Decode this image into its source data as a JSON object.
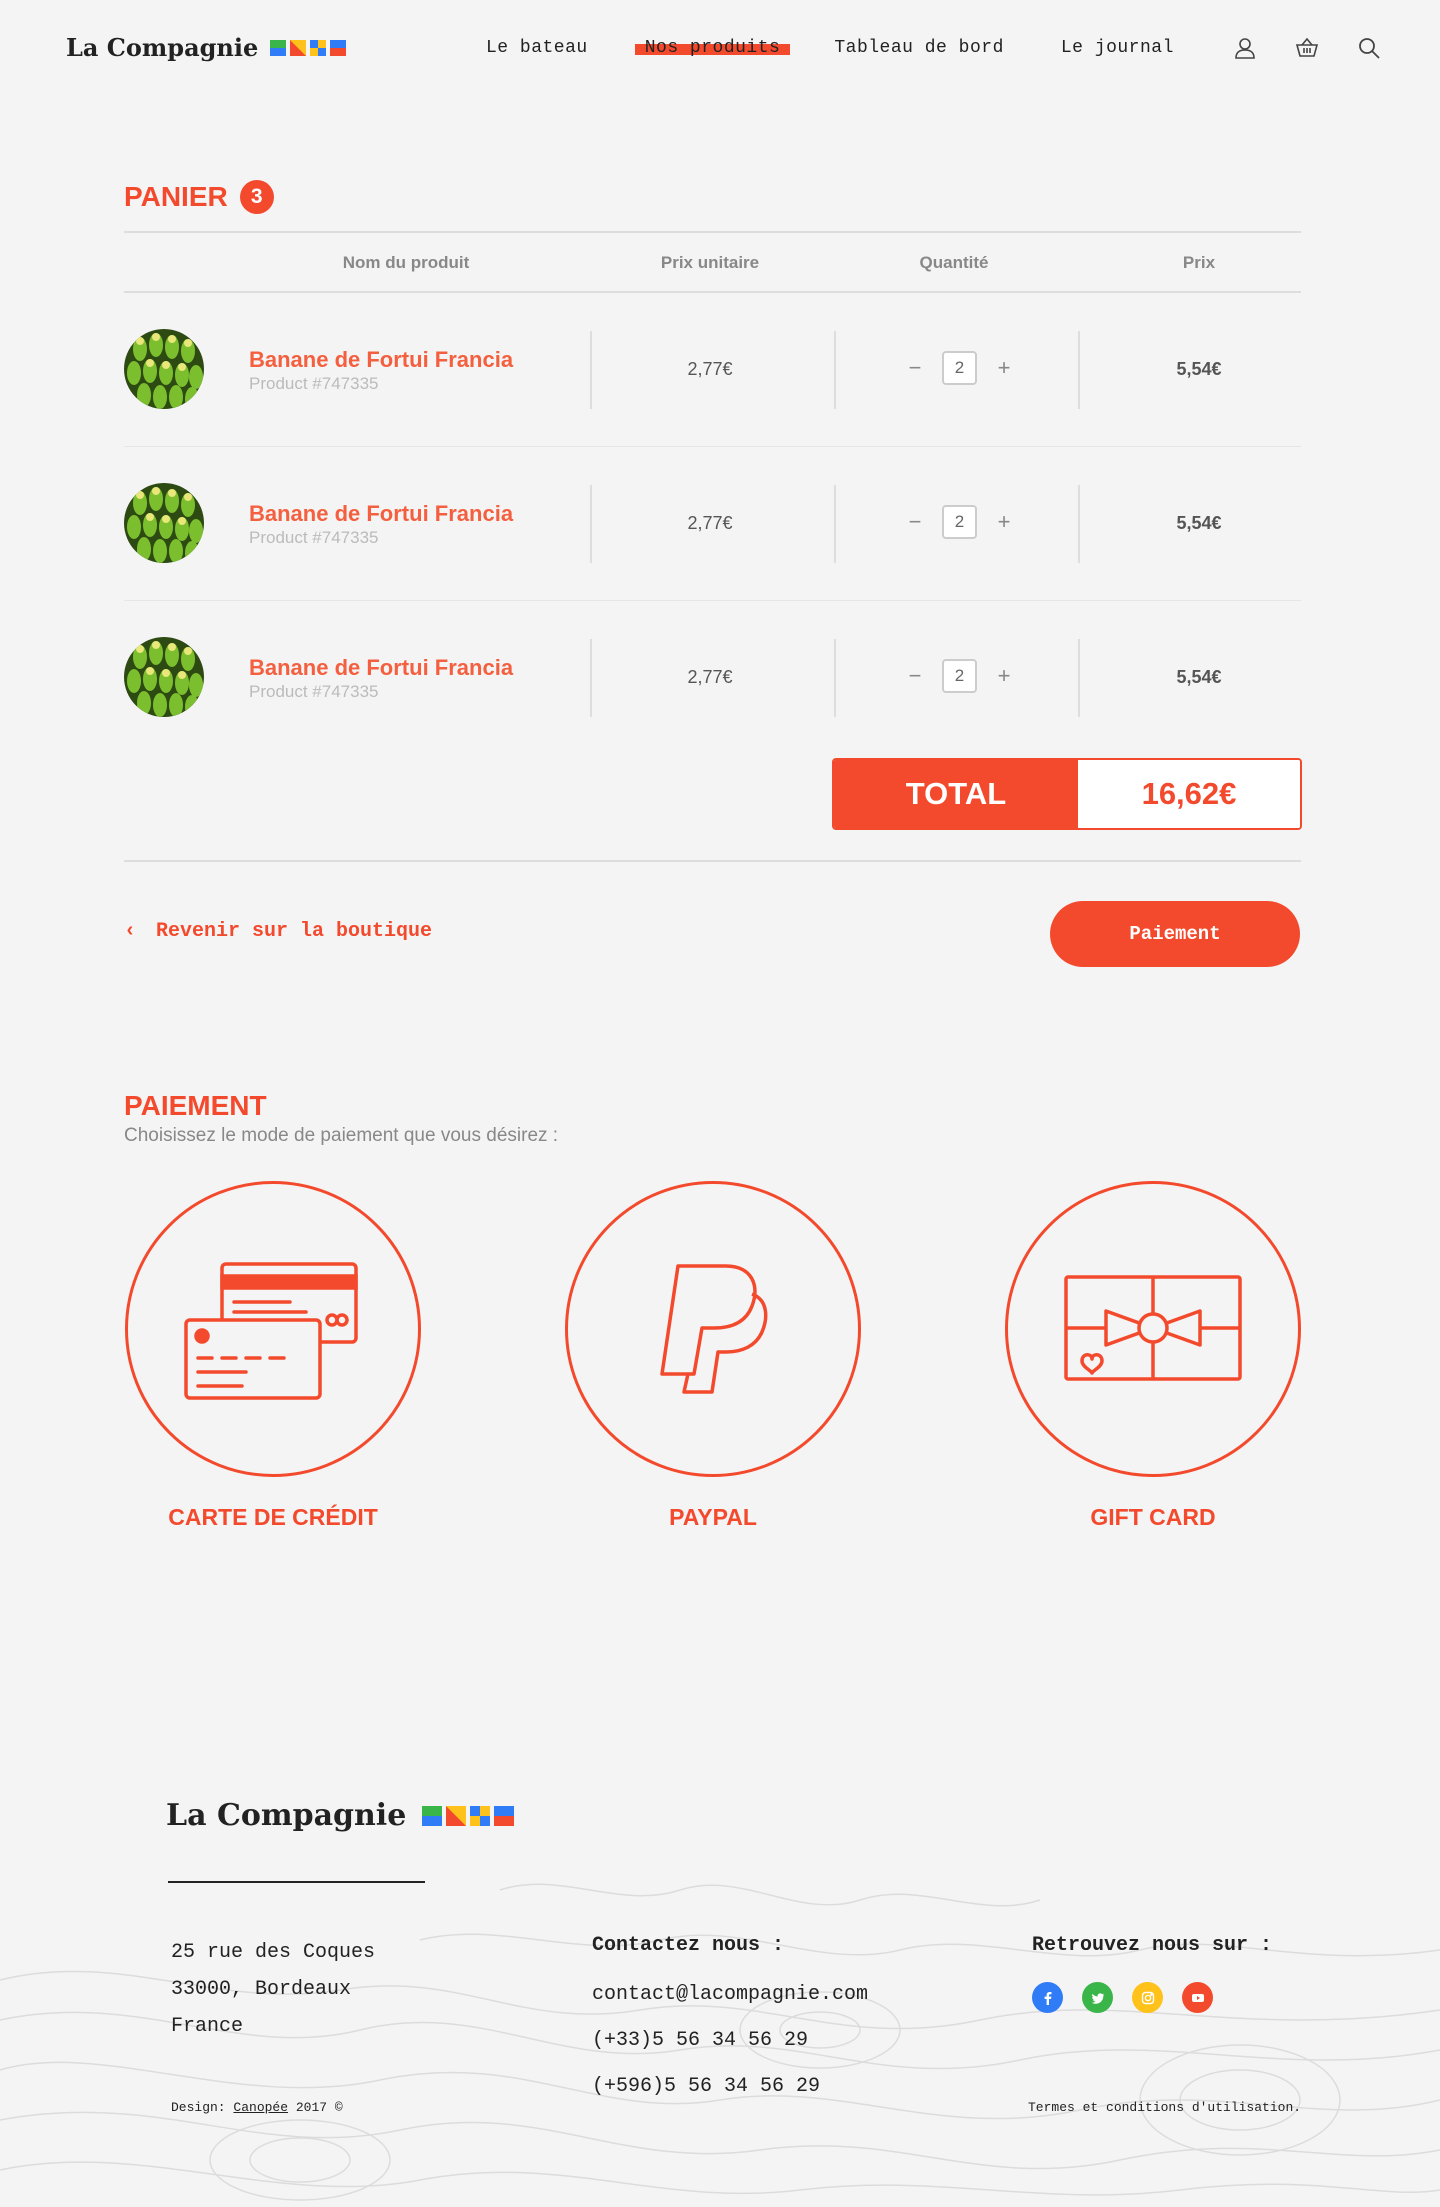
{
  "header": {
    "logo": "La Compagnie",
    "logo_colors": [
      "#2f7cf6",
      "#3ab54a",
      "#f34a2d",
      "#ffc21a",
      "#2f7cf6",
      "#f34a2d"
    ],
    "nav": [
      {
        "label": "Le bateau"
      },
      {
        "label": "Nos produits",
        "active": true
      },
      {
        "label": "Tableau de bord"
      },
      {
        "label": "Le journal"
      }
    ],
    "icons": [
      "user-icon",
      "basket-icon",
      "search-icon"
    ]
  },
  "cart": {
    "title": "PANIER",
    "count": "3",
    "columns": [
      "Nom du produit",
      "Prix unitaire",
      "Quantité",
      "Prix"
    ],
    "items": [
      {
        "name": "Banane de Fortui Francia",
        "id": "Product #747335",
        "unit_price": "2,77€",
        "qty": "2",
        "price": "5,54€"
      },
      {
        "name": "Banane de Fortui Francia",
        "id": "Product #747335",
        "unit_price": "2,77€",
        "qty": "2",
        "price": "5,54€"
      },
      {
        "name": "Banane de Fortui Francia",
        "id": "Product #747335",
        "unit_price": "2,77€",
        "qty": "2",
        "price": "5,54€"
      }
    ],
    "qty_minus": "−",
    "qty_plus": "+",
    "total_label": "TOTAL",
    "total_value": "16,62€",
    "back_icon": "‹",
    "back_label": "Revenir sur la boutique",
    "pay_label": "Paiement"
  },
  "payment": {
    "title": "PAIEMENT",
    "subtitle": "Choisissez le mode de paiement que vous désirez :",
    "methods": [
      {
        "label": "CARTE DE CRÉDIT",
        "icon": "credit-card-icon"
      },
      {
        "label": "PAYPAL",
        "icon": "paypal-icon"
      },
      {
        "label": "GIFT CARD",
        "icon": "gift-card-icon"
      }
    ]
  },
  "footer": {
    "logo": "La Compagnie",
    "address": [
      "25 rue des Coques",
      "33000, Bordeaux",
      "France"
    ],
    "contact_title": "Contactez nous :",
    "email": "contact@lacompagnie.com",
    "phone1": "(+33)5 56 34 56 29",
    "phone2": "(+596)5 56 34 56 29",
    "social_title": "Retrouvez nous sur :",
    "social": [
      {
        "name": "facebook-icon",
        "color": "#2f7cf6"
      },
      {
        "name": "twitter-icon",
        "color": "#3ab54a"
      },
      {
        "name": "instagram-icon",
        "color": "#ffc21a"
      },
      {
        "name": "youtube-icon",
        "color": "#f34a2d"
      }
    ],
    "credit_prefix": "Design:",
    "credit_link": "Canopée",
    "credit_suffix": "2017 ©",
    "terms": "Termes et conditions d'utilisation."
  },
  "accent_color": "#f34a2d"
}
